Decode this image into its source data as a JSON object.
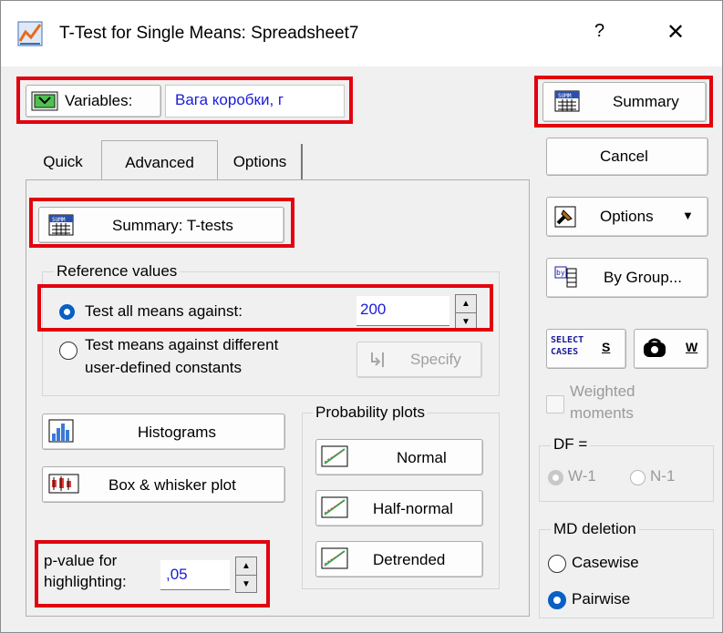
{
  "window": {
    "title": "T-Test for Single Means: Spreadsheet7",
    "help": "?",
    "close": "✕"
  },
  "variables": {
    "label": "Variables:",
    "value": "Вага коробки, г"
  },
  "tabs": [
    "Quick",
    "Advanced",
    "Options"
  ],
  "advanced": {
    "summary_ttests": "Summary: T-tests",
    "reference_values": "Reference values",
    "test_all_label": "Test all means against:",
    "test_all_value": "200",
    "test_diff_line1": "Test means against different",
    "test_diff_line2": "user-defined constants",
    "specify": "Specify",
    "histograms": "Histograms",
    "box_whisker": "Box & whisker plot",
    "probability_plots": "Probability plots",
    "normal": "Normal",
    "half_normal": "Half-normal",
    "detrended": "Detrended",
    "pvalue_line1": "p-value for",
    "pvalue_line2": "highlighting:",
    "pvalue_value": ",05"
  },
  "right": {
    "summary": "Summary",
    "cancel": "Cancel",
    "options": "Options",
    "by_group": "By Group...",
    "select_cases_line1": "SELECT",
    "select_cases_line2": "CASES",
    "s_label": "S",
    "w_label": "W",
    "weighted_line1": "Weighted",
    "weighted_line2": "moments",
    "df_label": "DF =",
    "df_w1": "W-1",
    "df_n1": "N-1",
    "md_deletion": "MD deletion",
    "casewise": "Casewise",
    "pairwise": "Pairwise"
  },
  "colors": {
    "highlight": "#e3000f",
    "accent": "#0a5fc4",
    "value_text": "#1b1bd8"
  }
}
